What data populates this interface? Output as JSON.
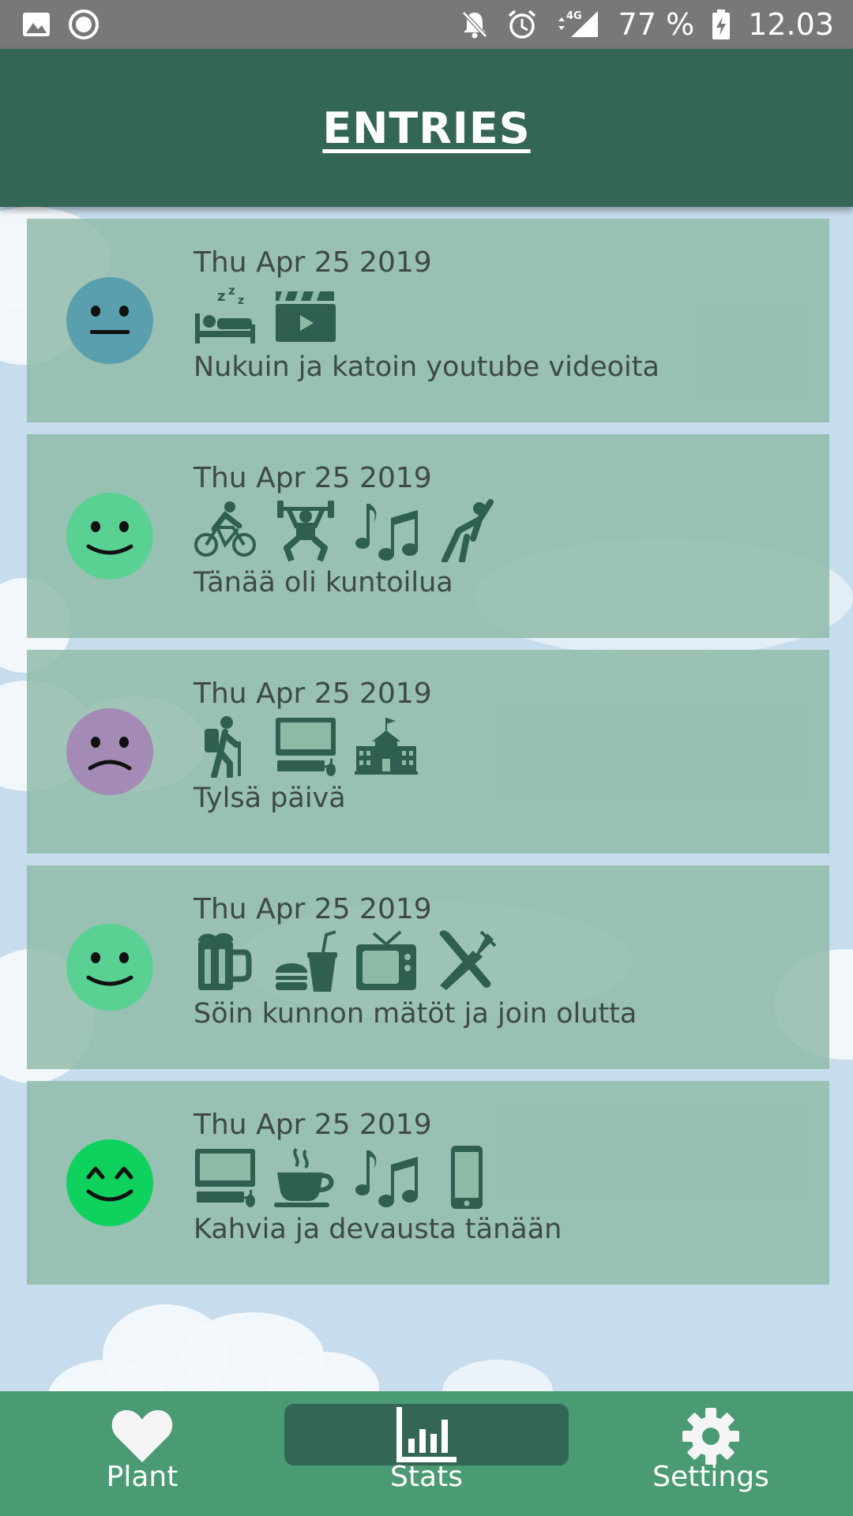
{
  "status_bar": {
    "battery": "77 %",
    "time": "12.03",
    "network": "4G"
  },
  "header": {
    "title": "ENTRIES"
  },
  "colors": {
    "header": "#346655",
    "nav": "#4a9a73",
    "card": "#8dbaa6",
    "icon": "#2f5f50",
    "mood_neutral": "#5a9fae",
    "mood_happy": "#59d193",
    "mood_sad": "#a48bb6",
    "mood_very_happy": "#0fd15e"
  },
  "entries": [
    {
      "date": "Thu Apr 25 2019",
      "mood": "neutral-face-icon",
      "activities": [
        "sleep-bed-icon",
        "video-clapperboard-icon"
      ],
      "note": "Nukuin ja katoin youtube videoita"
    },
    {
      "date": "Thu Apr 25 2019",
      "mood": "smiling-face-icon",
      "activities": [
        "cycling-icon",
        "weightlifting-icon",
        "music-notes-icon",
        "stretching-icon"
      ],
      "note": "Tänää oli kuntoilua"
    },
    {
      "date": "Thu Apr 25 2019",
      "mood": "sad-face-icon",
      "activities": [
        "hiking-icon",
        "computer-icon",
        "school-icon"
      ],
      "note": "Tylsä päivä"
    },
    {
      "date": "Thu Apr 25 2019",
      "mood": "smiling-face-icon",
      "activities": [
        "beer-mug-icon",
        "fast-food-icon",
        "television-icon",
        "utensils-icon"
      ],
      "note": "Söin kunnon mätöt ja join olutta"
    },
    {
      "date": "Thu Apr 25 2019",
      "mood": "grinning-face-icon",
      "activities": [
        "computer-icon",
        "coffee-cup-icon",
        "music-notes-icon",
        "smartphone-icon"
      ],
      "note": "Kahvia ja devausta tänään"
    }
  ],
  "nav": {
    "items": [
      {
        "label": "Plant",
        "icon": "heart-icon"
      },
      {
        "label": "Stats",
        "icon": "bar-chart-icon",
        "active": true
      },
      {
        "label": "Settings",
        "icon": "gear-icon"
      }
    ]
  }
}
